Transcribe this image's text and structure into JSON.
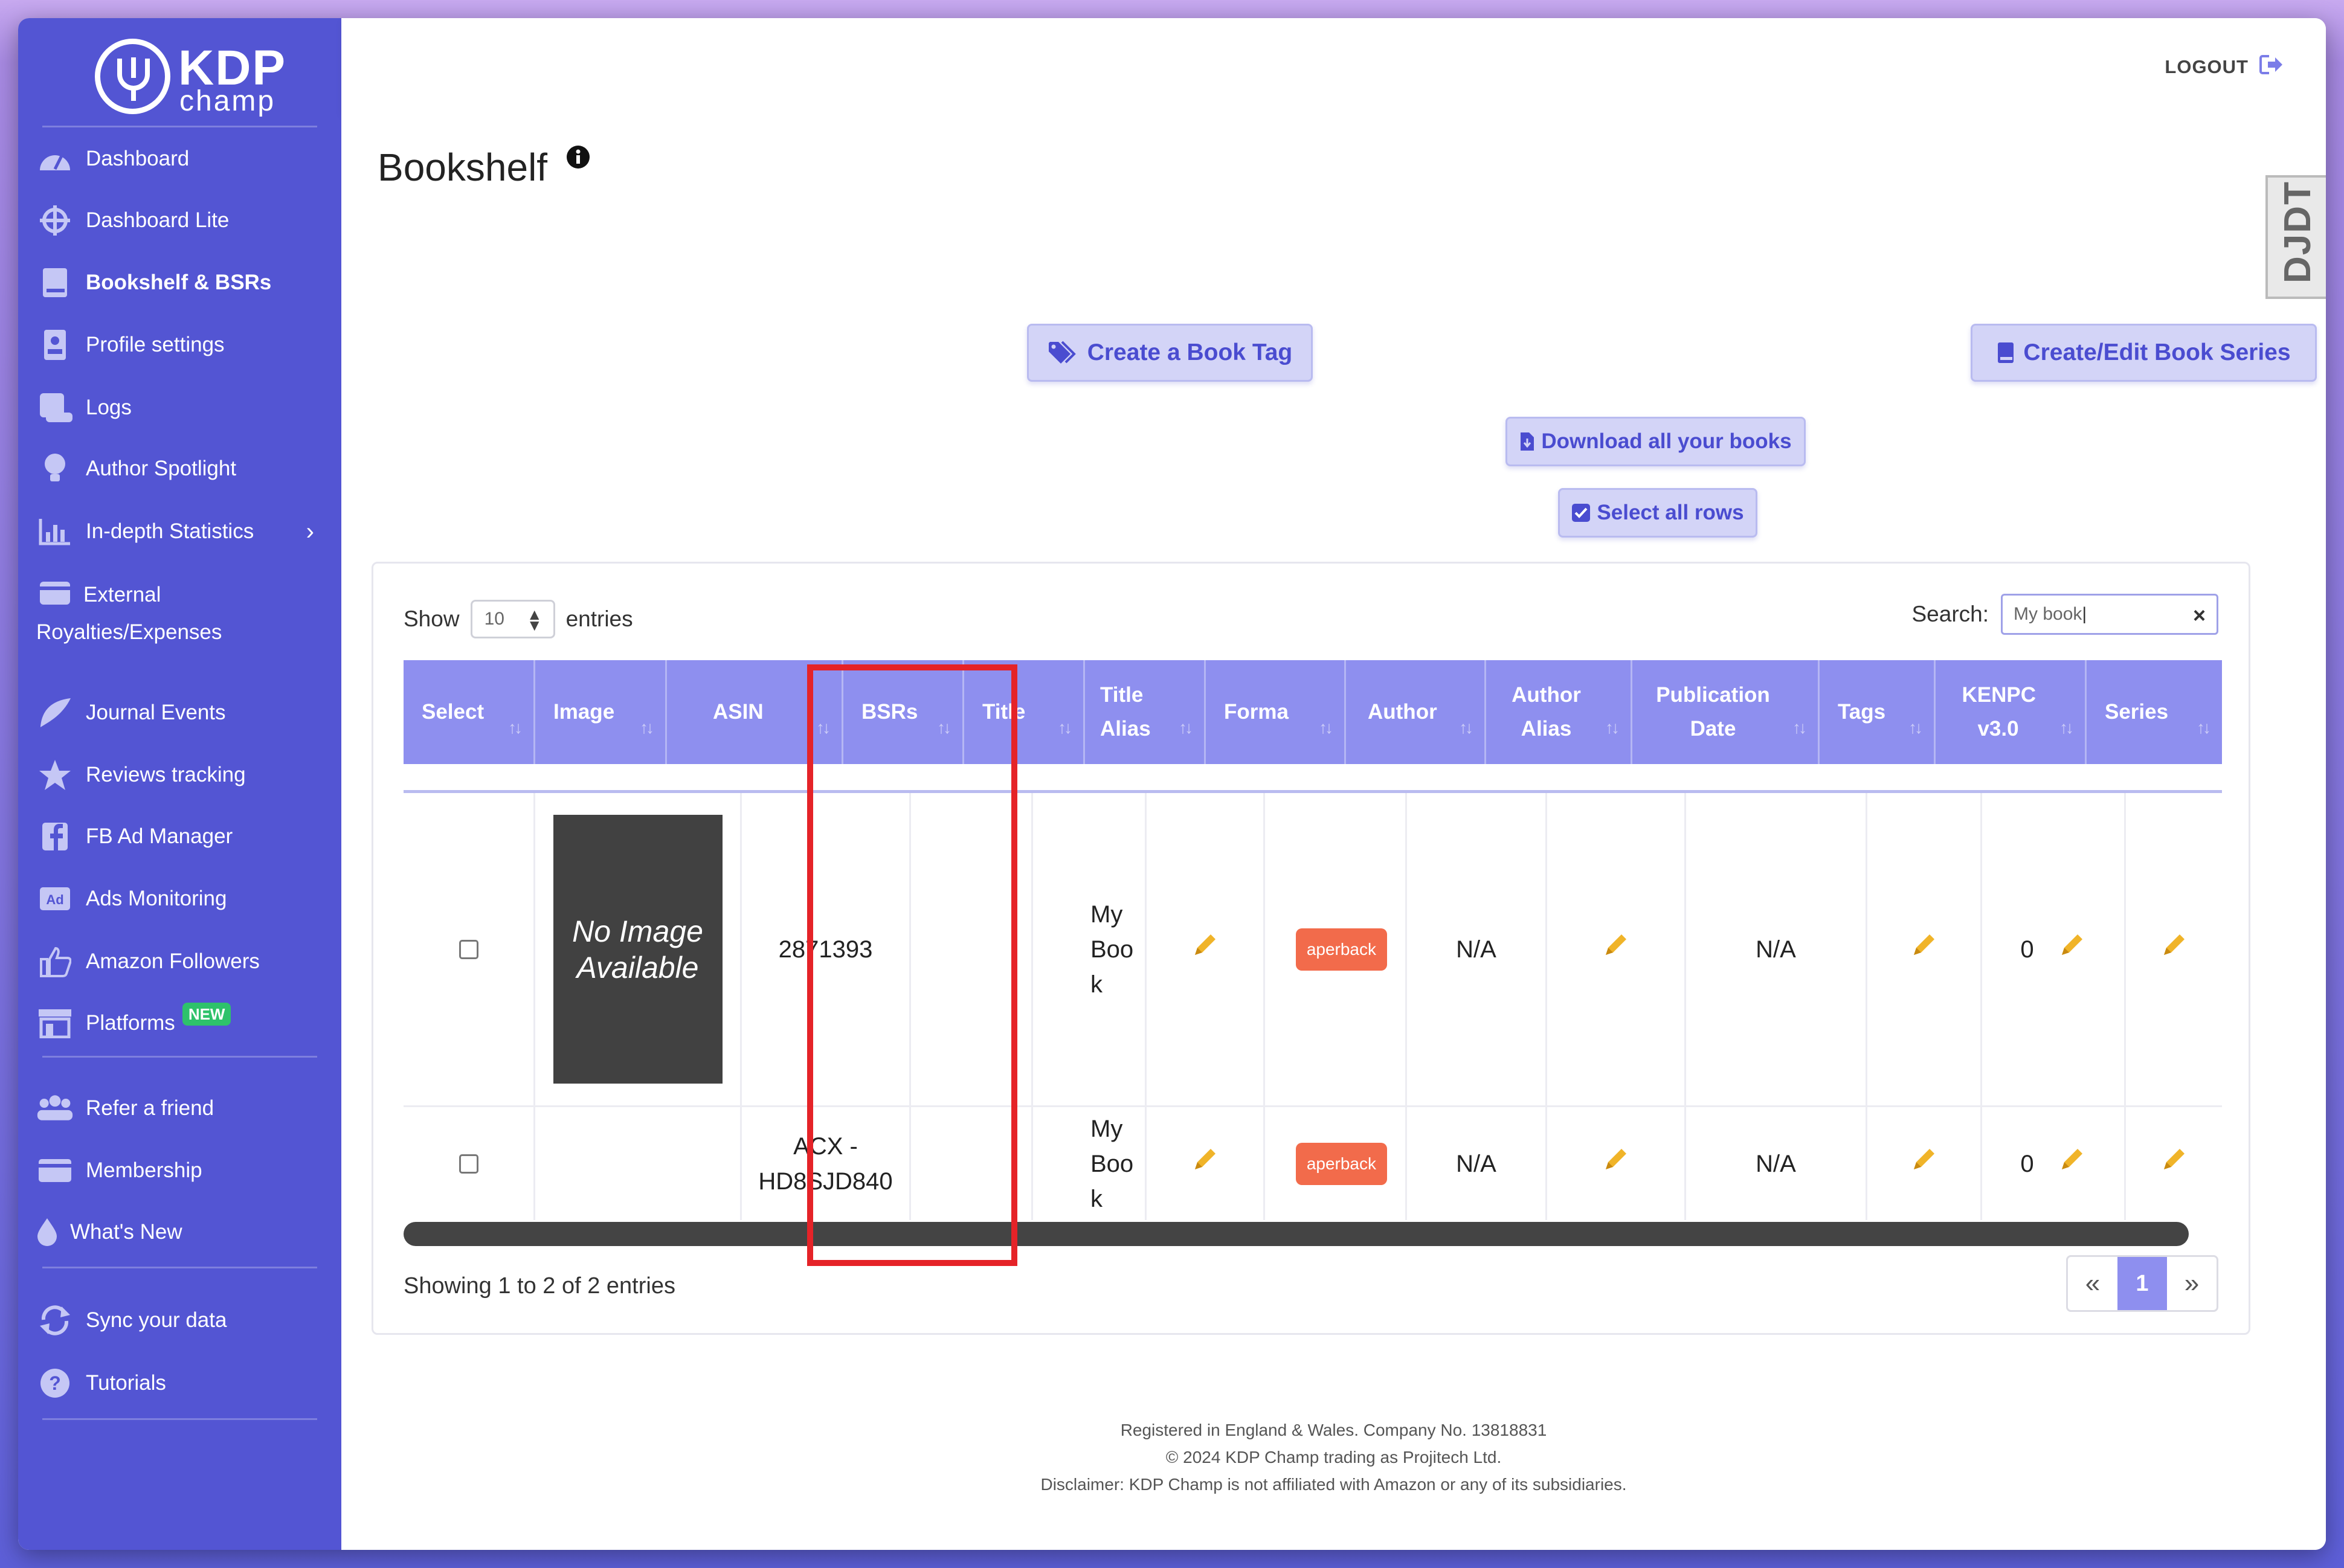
{
  "brand": {
    "word1": "KDP",
    "word2": "champ"
  },
  "sidebar": {
    "items": [
      {
        "label": "Dashboard",
        "icon": "dashboard-gauge-icon"
      },
      {
        "label": "Dashboard Lite",
        "icon": "crosshair-icon"
      },
      {
        "label": "Bookshelf & BSRs",
        "icon": "book-icon",
        "active": true
      },
      {
        "label": "Profile settings",
        "icon": "id-card-icon"
      },
      {
        "label": "Logs",
        "icon": "scroll-icon"
      },
      {
        "label": "Author Spotlight",
        "icon": "lightbulb-icon"
      },
      {
        "label": "In-depth Statistics",
        "icon": "bar-chart-icon"
      },
      {
        "label": "External Royalties/Expenses",
        "icon": "wallet-icon"
      },
      {
        "label": "Journal Events",
        "icon": "feather-icon"
      },
      {
        "label": "Reviews tracking",
        "icon": "star-icon"
      },
      {
        "label": "FB Ad Manager",
        "icon": "facebook-icon"
      },
      {
        "label": "Ads Monitoring",
        "icon": "ad-icon"
      },
      {
        "label": "Amazon Followers",
        "icon": "thumbs-up-icon"
      },
      {
        "label": "Platforms",
        "icon": "store-icon",
        "badge": "NEW"
      },
      {
        "label": "Refer a friend",
        "icon": "users-icon"
      },
      {
        "label": "Membership",
        "icon": "membership-card-icon"
      },
      {
        "label": "What's New",
        "icon": "droplet-icon"
      },
      {
        "label": "Sync your data",
        "icon": "sync-icon"
      },
      {
        "label": "Tutorials",
        "icon": "question-circle-icon"
      }
    ]
  },
  "topbar": {
    "logout": "LOGOUT"
  },
  "page": {
    "title": "Bookshelf",
    "side_tab": "DJDT"
  },
  "actions": {
    "create_tag": "Create a Book Tag",
    "create_series": "Create/Edit Book Series",
    "download": "Download all your books",
    "select_all": "Select all rows"
  },
  "table": {
    "show_label": "Show",
    "show_value": "10",
    "entries_label": "entries",
    "search_label": "Search:",
    "search_value": "My book",
    "columns": [
      "Select",
      "Image",
      "ASIN",
      "BSRs",
      "Title",
      "Title Alias",
      "Forma",
      "Author",
      "Author Alias",
      "Publication Date",
      "Tags",
      "KENPC v3.0",
      "Series"
    ],
    "rows": [
      {
        "image": "No Image Available",
        "asin": "2871393",
        "title": "My Book",
        "format": "aperback",
        "author": "N/A",
        "pub_date": "N/A",
        "kenpc": "0"
      },
      {
        "image": "",
        "asin": "ACX - HD8SJD840",
        "title": "My Book",
        "format": "aperback",
        "author": "N/A",
        "pub_date": "N/A",
        "kenpc": "0"
      }
    ],
    "showing": "Showing 1 to 2 of 2 entries",
    "pager": {
      "prev": "«",
      "current": "1",
      "next": "»"
    }
  },
  "footer": {
    "line1": "Registered in England & Wales. Company No. 13818831",
    "line2": "© 2024 KDP Champ trading as Projitech Ltd.",
    "line3": "Disclaimer: KDP Champ is not affiliated with Amazon or any of its subsidiaries."
  },
  "colors": {
    "sidebar": "#5355d3",
    "accent": "#8e8fef",
    "button_bg": "#d3d4f7",
    "highlight": "#e52328",
    "chat": "#5a13c8"
  }
}
